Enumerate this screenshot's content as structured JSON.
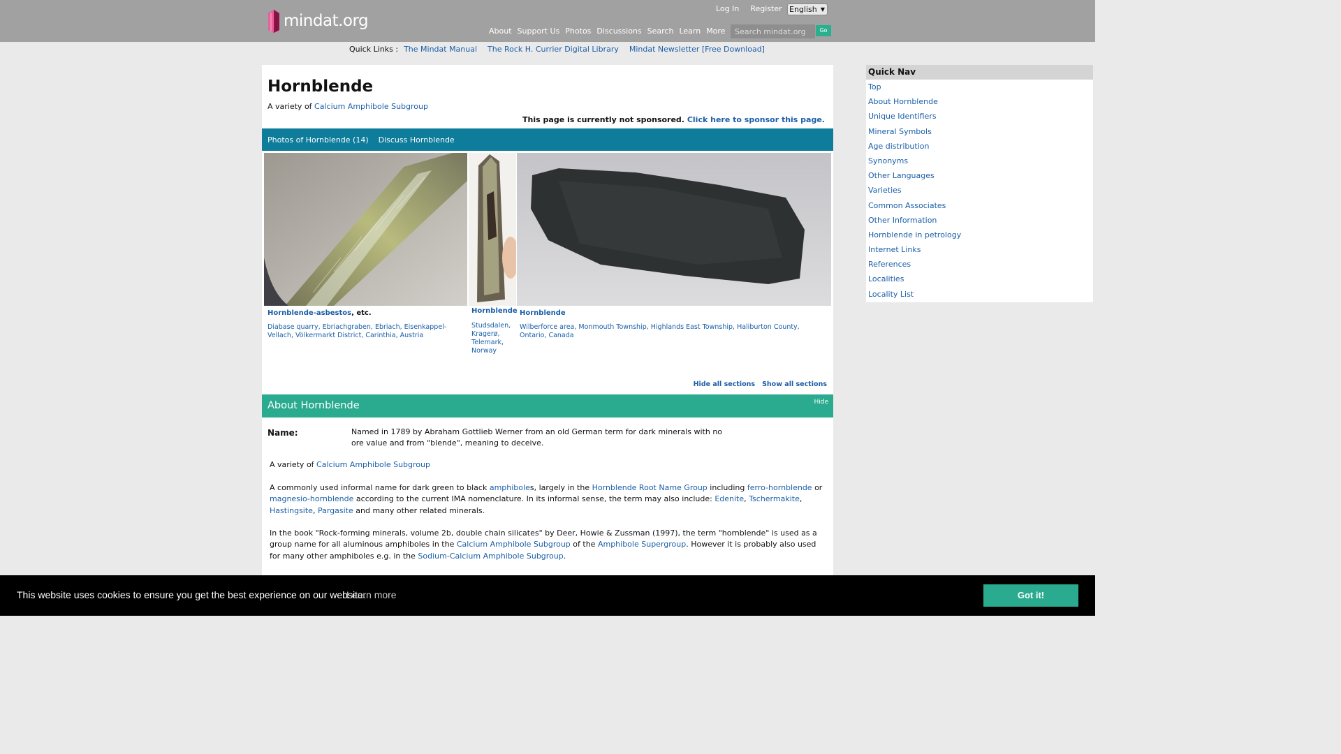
{
  "header": {
    "logo_text": "mindat.org",
    "login": "Log In",
    "register": "Register",
    "language": "English",
    "nav": [
      "About",
      "Support Us",
      "Photos",
      "Discussions",
      "Search",
      "Learn",
      "More"
    ],
    "search_placeholder": "Search mindat.org",
    "go": "Go"
  },
  "quicklinks": {
    "label": "Quick Links :",
    "items": [
      "The Mindat Manual",
      "The Rock H. Currier Digital Library",
      "Mindat Newsletter [Free Download]"
    ]
  },
  "page": {
    "title": "Hornblende",
    "variety_prefix": "A variety of",
    "variety_link": "Calcium Amphibole Subgroup",
    "sponsor_text": "This page is currently not sponsored.",
    "sponsor_link": "Click here to sponsor this page.",
    "tabs": [
      "Photos of Hornblende (14)",
      "Discuss Hornblende"
    ]
  },
  "photos": [
    {
      "name": "Hornblende-asbestos",
      "suffix": ", etc.",
      "location": "Diabase quarry, Ebriachgraben, Ebriach, Eisenkappel-Vellach, Völkermarkt District, Carinthia, Austria"
    },
    {
      "name": "Hornblende",
      "suffix": "",
      "location": "Studsdalen, Kragerø, Telemark, Norway"
    },
    {
      "name": "Hornblende",
      "suffix": "",
      "location": "Wilberforce area, Monmouth Township, Highlands East Township, Haliburton County, Ontario, Canada"
    }
  ],
  "sections": {
    "hide_all": "Hide all sections",
    "show_all": "Show all sections",
    "about_title": "About Hornblende",
    "hide": "Hide"
  },
  "about": {
    "name_label": "Name:",
    "name_text": "Named in 1789 by Abraham Gottlieb Werner from an old German term for dark minerals with no ore value and from \"blende\", meaning to deceive.",
    "variety_prefix": "A variety of",
    "variety_link": "Calcium Amphibole Subgroup",
    "p2": {
      "t1": "A commonly used informal name for dark green to black ",
      "l1": "amphibole",
      "t2": "s, largely in the ",
      "l2": "Hornblende Root Name Group",
      "t3": " including ",
      "l3": "ferro-hornblende",
      "t4": " or ",
      "l4": "magnesio-hornblende",
      "t5": " according to the current IMA nomenclature. In its informal sense, the term may also include: ",
      "l5": "Edenite",
      "l6": "Tschermakite",
      "l7": "Hastingsite",
      "l8": "Pargasite",
      "sep": ", ",
      "t6": " and many other related minerals."
    },
    "p3": {
      "t1": "In the book \"Rock-forming minerals, volume 2b, double chain silicates\" by Deer, Howie & Zussman (1997), the term \"hornblende\" is used as a group name for all aluminous amphiboles in the ",
      "l1": "Calcium Amphibole Subgroup",
      "t2": " of the ",
      "l2": "Amphibole Supergroup",
      "t3": ". However it is probably also used for many other amphiboles e.g. in the ",
      "l3": "Sodium-Calcium Amphibole Subgroup",
      "t4": "."
    }
  },
  "quicknav": {
    "title": "Quick Nav",
    "items": [
      "Top",
      "About Hornblende",
      "Unique Identifiers",
      "Mineral Symbols",
      "Age distribution",
      "Synonyms",
      "Other Languages",
      "Varieties",
      "Common Associates",
      "Other Information",
      "Hornblende in petrology",
      "Internet Links",
      "References",
      "Localities",
      "Locality List"
    ]
  },
  "cookie": {
    "message": "This website uses cookies to ensure you get the best experience on our website.",
    "learn_more": "Learn more",
    "button": "Got it!"
  }
}
